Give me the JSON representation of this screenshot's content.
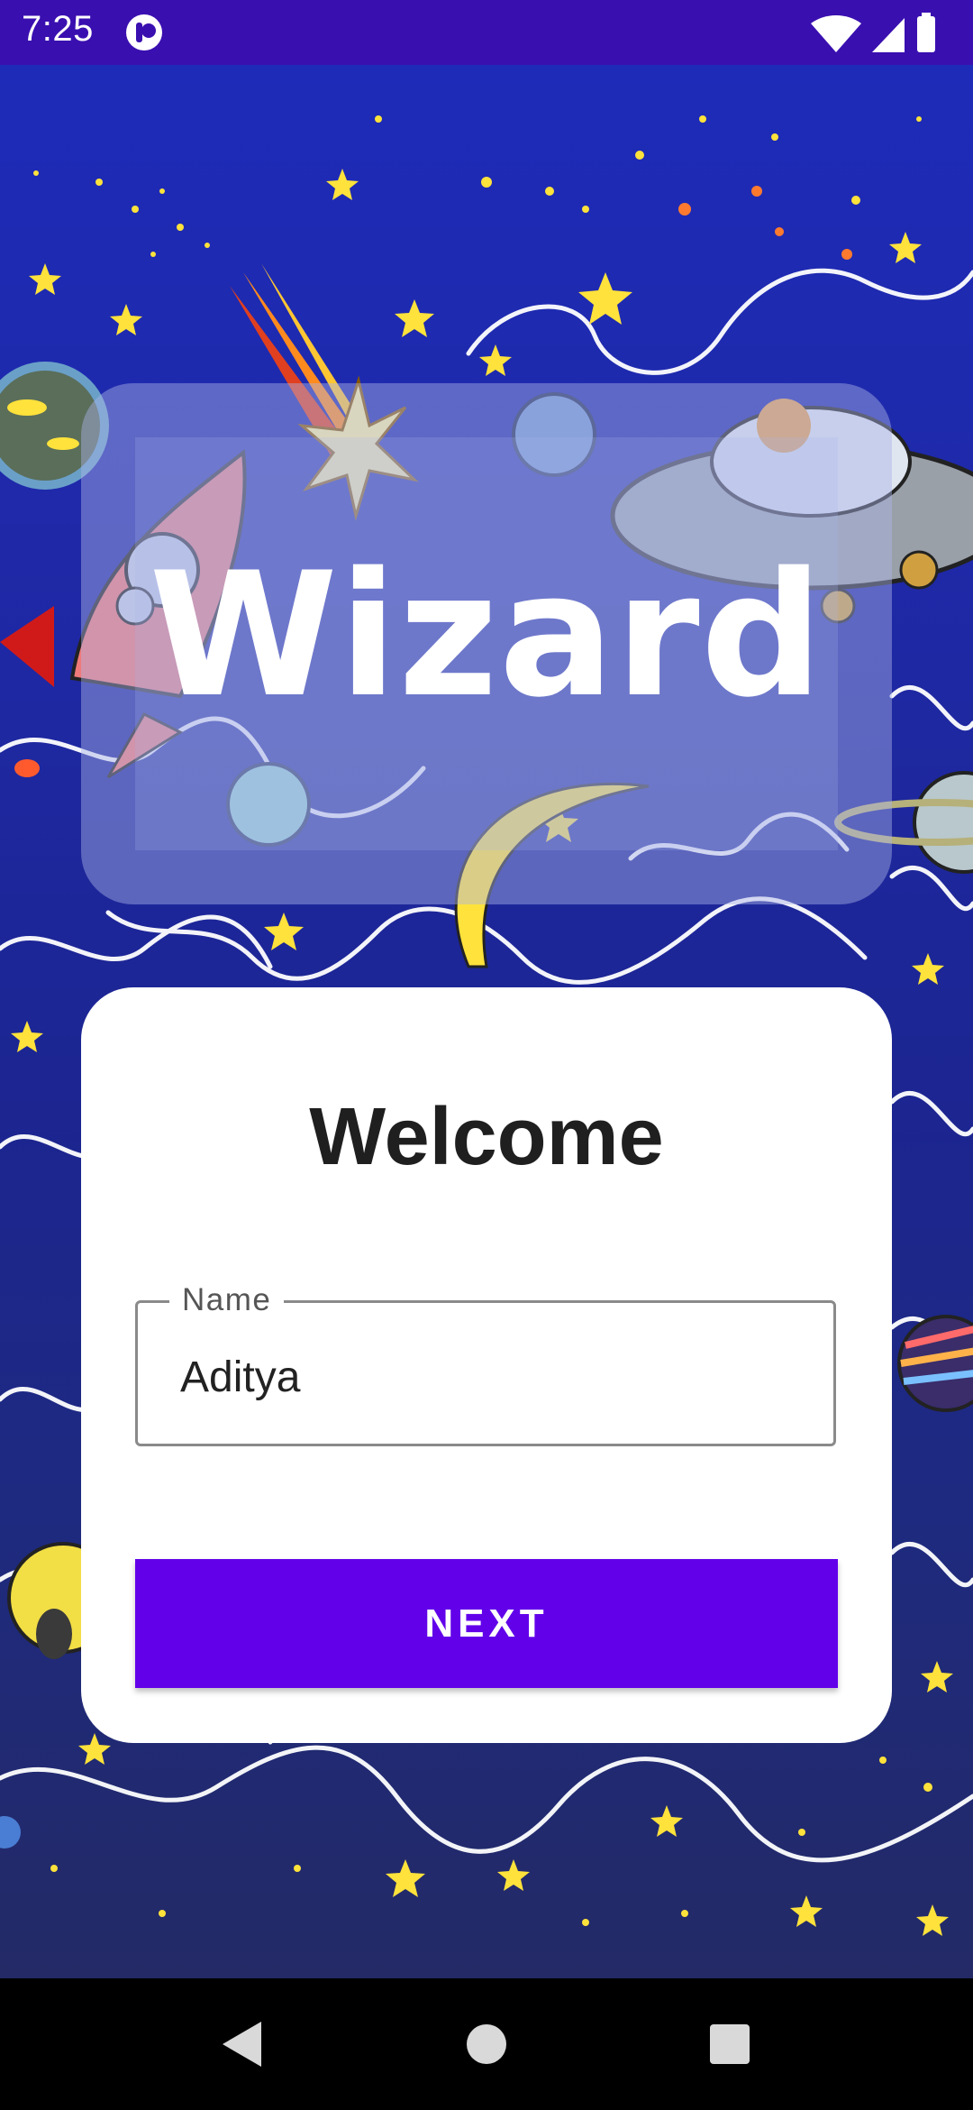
{
  "status_bar": {
    "time": "7:25",
    "icons": [
      "app-notification-icon",
      "wifi-icon",
      "signal-icon",
      "battery-icon"
    ],
    "background_color": "#3a0fb0"
  },
  "background": {
    "theme": "cartoon outer space illustration with rocket, UFO, planets and stars",
    "gradient_top": "#1d2bb8",
    "gradient_bottom": "#232a66"
  },
  "header": {
    "title": "Wizard"
  },
  "card": {
    "title": "Welcome",
    "name_field": {
      "label": "Name",
      "value": "Aditya"
    },
    "next_button_label": "NEXT"
  },
  "accent_color": "#6200ea",
  "nav_bar": {
    "buttons": [
      "back-icon",
      "home-icon",
      "recents-icon"
    ]
  }
}
